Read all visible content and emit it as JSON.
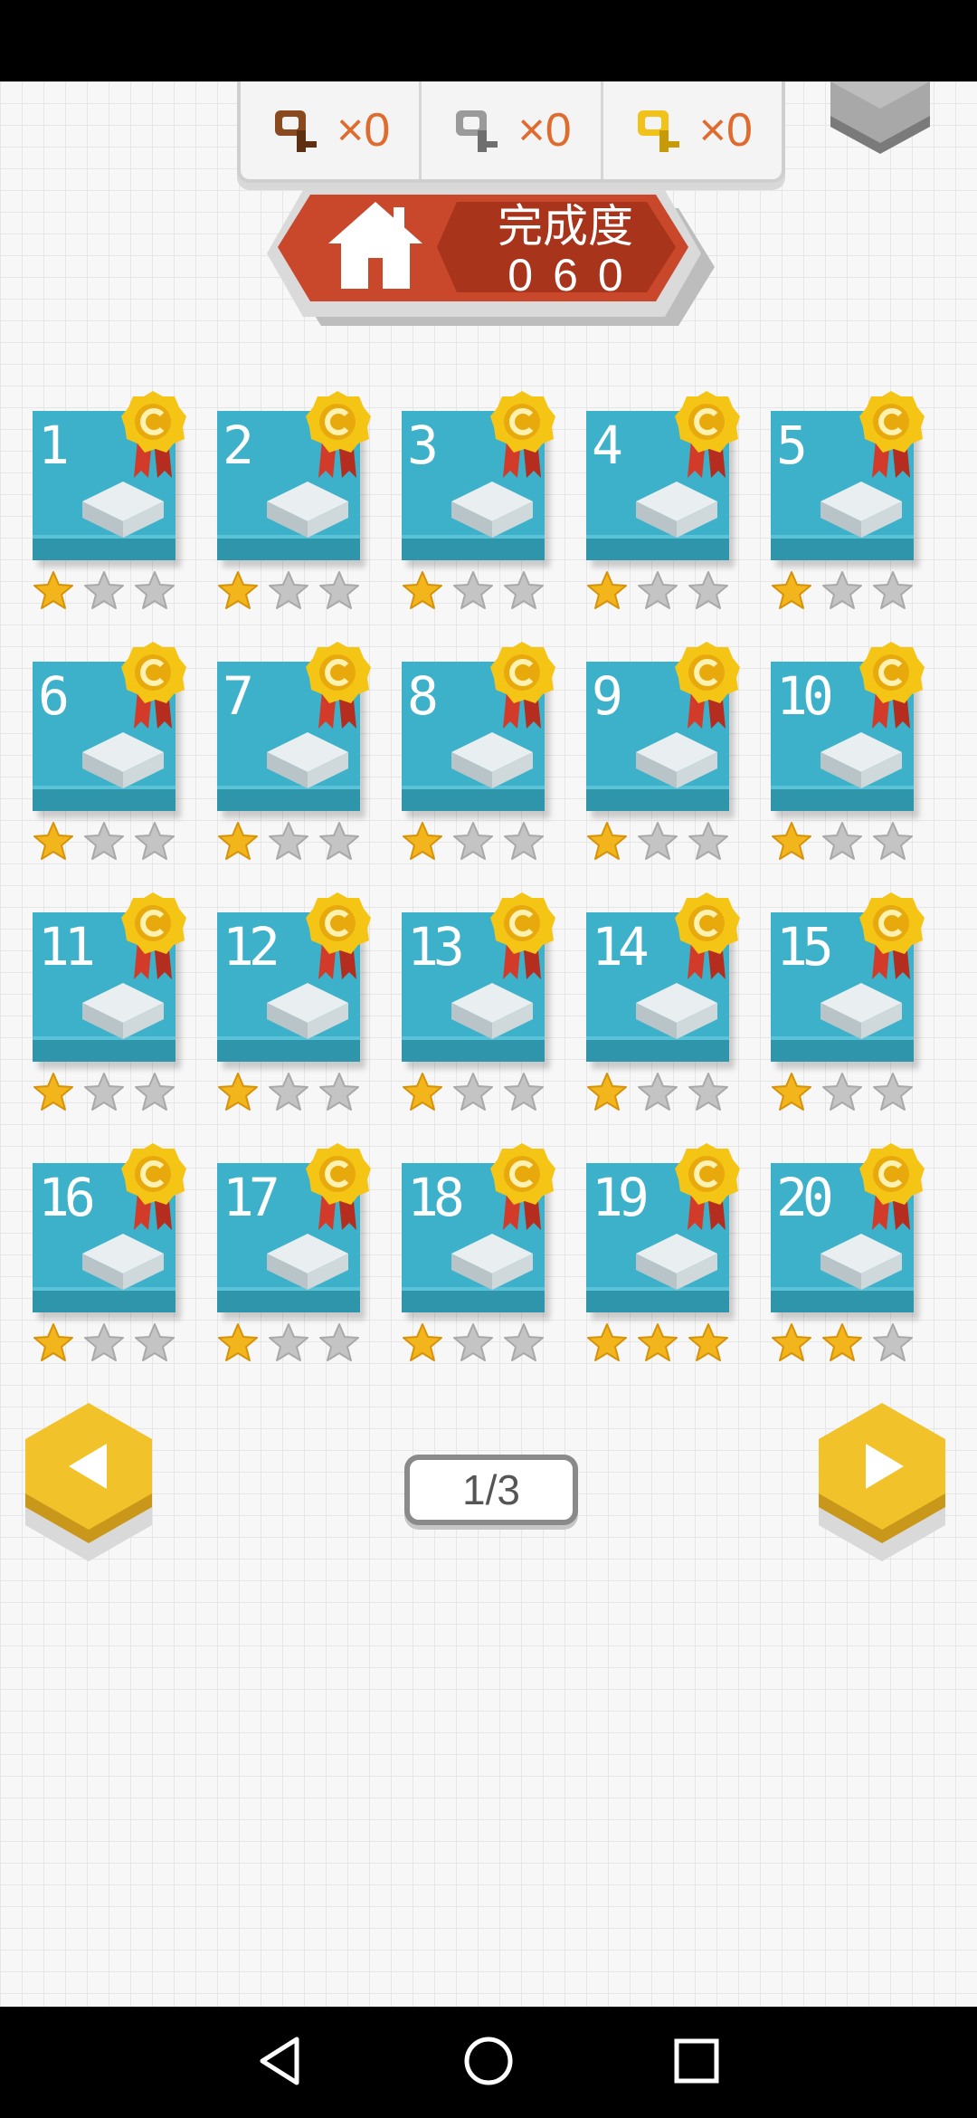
{
  "keys": [
    {
      "name": "bronze-key",
      "color": "#8a4a1f",
      "count": "×0"
    },
    {
      "name": "silver-key",
      "color": "#9a9a9a",
      "count": "×0"
    },
    {
      "name": "gold-key",
      "color": "#f0c21a",
      "count": "×0"
    }
  ],
  "progress": {
    "label": "完成度",
    "value": "060"
  },
  "colors": {
    "banner": "#c9472b",
    "card": "#3cb1c9",
    "star_on": "#f2b51c",
    "star_off": "#c4c4c4",
    "hex": "#f2c22a"
  },
  "levels": [
    {
      "number": "1",
      "stars": 1
    },
    {
      "number": "2",
      "stars": 1
    },
    {
      "number": "3",
      "stars": 1
    },
    {
      "number": "4",
      "stars": 1
    },
    {
      "number": "5",
      "stars": 1
    },
    {
      "number": "6",
      "stars": 1
    },
    {
      "number": "7",
      "stars": 1
    },
    {
      "number": "8",
      "stars": 1
    },
    {
      "number": "9",
      "stars": 1
    },
    {
      "number": "10",
      "stars": 1
    },
    {
      "number": "11",
      "stars": 1
    },
    {
      "number": "12",
      "stars": 1
    },
    {
      "number": "13",
      "stars": 1
    },
    {
      "number": "14",
      "stars": 1
    },
    {
      "number": "15",
      "stars": 1
    },
    {
      "number": "16",
      "stars": 1
    },
    {
      "number": "17",
      "stars": 1
    },
    {
      "number": "18",
      "stars": 1
    },
    {
      "number": "19",
      "stars": 3
    },
    {
      "number": "20",
      "stars": 2
    }
  ],
  "max_stars": 3,
  "pager": {
    "page": "1/3"
  },
  "nav_bar": {
    "back": "back-icon",
    "home": "home-circle-icon",
    "recents": "recents-icon"
  }
}
